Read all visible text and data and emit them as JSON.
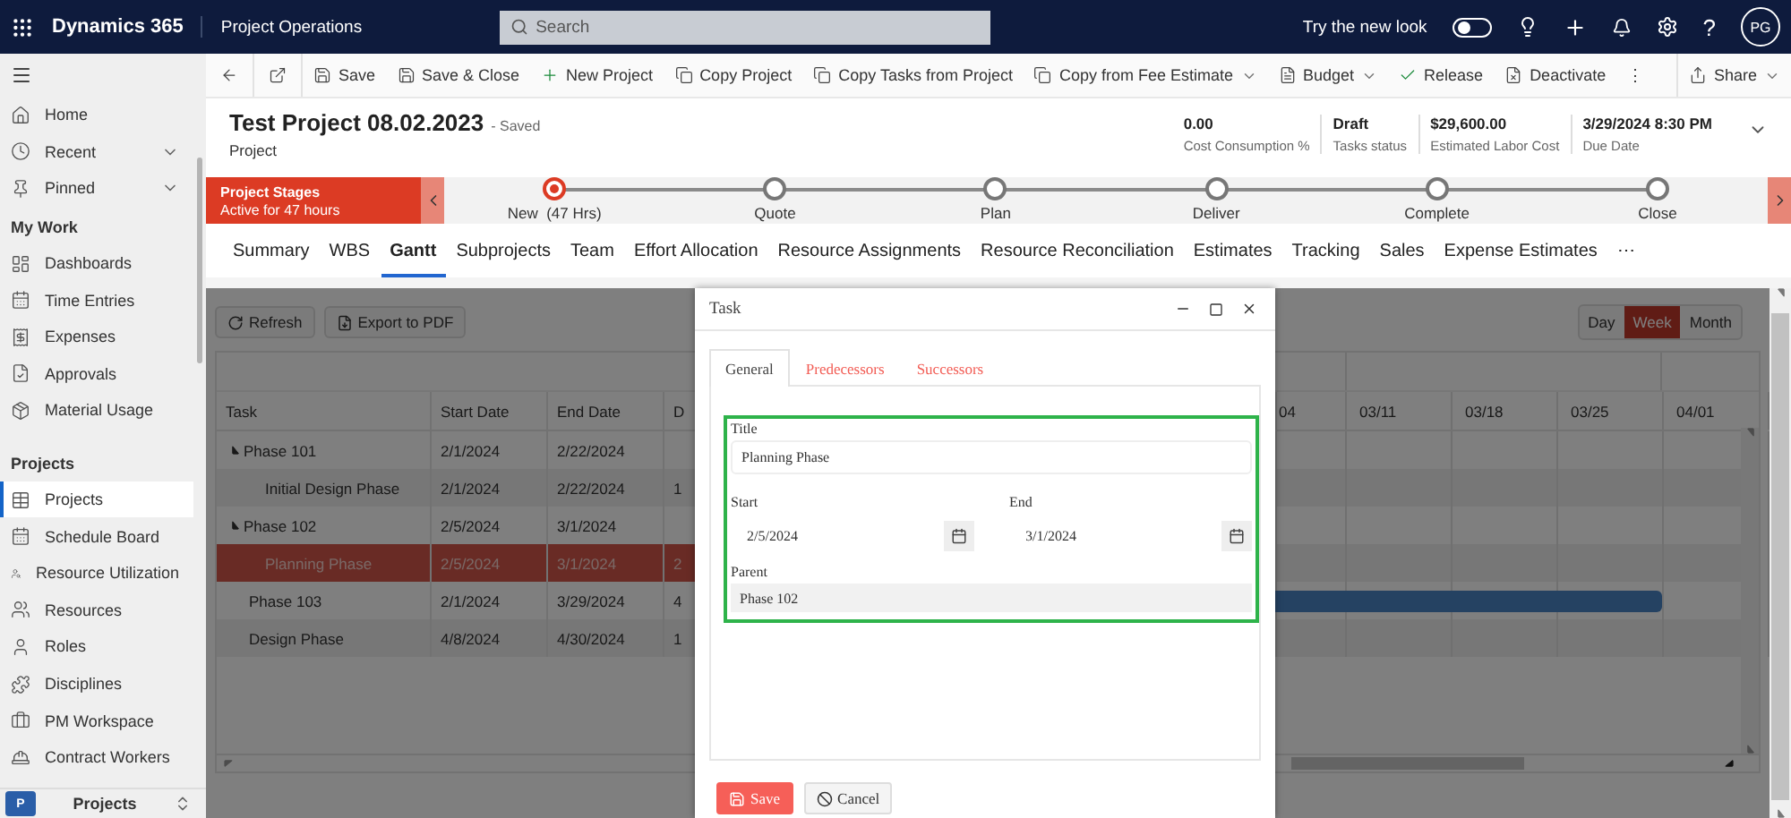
{
  "top_bar": {
    "app_name": "Dynamics 365",
    "area": "Project Operations",
    "search": {
      "placeholder": "Search"
    },
    "new_look": {
      "label": "Try the new look",
      "on": false
    },
    "help": "?",
    "avatar": "PG"
  },
  "sidebar": {
    "items": [
      {
        "label": "Home",
        "kind": "home",
        "selected": false,
        "expandable": false
      },
      {
        "label": "Recent",
        "kind": "recent",
        "selected": false,
        "expandable": true
      },
      {
        "label": "Pinned",
        "kind": "pinned",
        "selected": false,
        "expandable": true
      }
    ],
    "sections": [
      {
        "title": "My Work",
        "items": [
          {
            "label": "Dashboards",
            "kind": "dashboards",
            "selected": false
          },
          {
            "label": "Time Entries",
            "kind": "calendar",
            "selected": false
          },
          {
            "label": "Expenses",
            "kind": "expenses",
            "selected": false
          },
          {
            "label": "Approvals",
            "kind": "approvals",
            "selected": false
          },
          {
            "label": "Material Usage",
            "kind": "material",
            "selected": false
          }
        ]
      },
      {
        "title": "Projects",
        "items": [
          {
            "label": "Projects",
            "kind": "table",
            "selected": true
          },
          {
            "label": "Schedule Board",
            "kind": "calendar",
            "selected": false
          },
          {
            "label": "Resource Utilization",
            "kind": "utilization",
            "selected": false
          },
          {
            "label": "Resources",
            "kind": "resources",
            "selected": false
          },
          {
            "label": "Roles",
            "kind": "roles",
            "selected": false
          },
          {
            "label": "Disciplines",
            "kind": "disciplines",
            "selected": false
          },
          {
            "label": "PM Workspace",
            "kind": "workspace",
            "selected": false
          },
          {
            "label": "Contract Workers",
            "kind": "workers",
            "selected": false
          }
        ]
      }
    ],
    "area_switcher": {
      "badge": "P",
      "label": "Projects"
    }
  },
  "command_bar": [
    {
      "kind": "back"
    },
    {
      "kind": "popout"
    },
    {
      "label": "Save",
      "kind": "save",
      "dropdown": false
    },
    {
      "label": "Save & Close",
      "kind": "save-close",
      "dropdown": false
    },
    {
      "label": "New Project",
      "kind": "new",
      "dropdown": false
    },
    {
      "label": "Copy Project",
      "kind": "copy",
      "dropdown": false
    },
    {
      "label": "Copy Tasks from Project",
      "kind": "copy",
      "dropdown": false
    },
    {
      "label": "Copy from Fee Estimate",
      "kind": "copy",
      "dropdown": true
    },
    {
      "label": "Budget",
      "kind": "document",
      "dropdown": true
    },
    {
      "label": "Release",
      "kind": "check",
      "dropdown": false
    },
    {
      "label": "Deactivate",
      "kind": "deactivate",
      "dropdown": false
    },
    {
      "label": "⋮",
      "kind": "more",
      "dropdown": false
    },
    {
      "label": "Share",
      "kind": "share",
      "dropdown": true
    }
  ],
  "header": {
    "title": "Test Project 08.02.2023",
    "status": "- Saved",
    "entity": "Project",
    "fields": [
      {
        "value": "0.00",
        "label": "Cost Consumption %"
      },
      {
        "value": "Draft",
        "label": "Tasks status"
      },
      {
        "value": "$29,600.00",
        "label": "Estimated Labor Cost"
      },
      {
        "value": "3/29/2024 8:30 PM",
        "label": "Due Date"
      }
    ]
  },
  "stages": {
    "title": "Project Stages",
    "subtitle": "Active for 47 hours",
    "items": [
      {
        "label": "New  (47 Hrs)",
        "selected": true
      },
      {
        "label": "Quote",
        "selected": false
      },
      {
        "label": "Plan",
        "selected": false
      },
      {
        "label": "Deliver",
        "selected": false
      },
      {
        "label": "Complete",
        "selected": false
      },
      {
        "label": "Close",
        "selected": false
      }
    ]
  },
  "tabs": [
    {
      "label": "Summary",
      "selected": false
    },
    {
      "label": "WBS",
      "selected": false
    },
    {
      "label": "Gantt",
      "selected": true
    },
    {
      "label": "Subprojects",
      "selected": false
    },
    {
      "label": "Team",
      "selected": false
    },
    {
      "label": "Effort Allocation",
      "selected": false
    },
    {
      "label": "Resource Assignments",
      "selected": false
    },
    {
      "label": "Resource Reconciliation",
      "selected": false
    },
    {
      "label": "Estimates",
      "selected": false
    },
    {
      "label": "Tracking",
      "selected": false
    },
    {
      "label": "Sales",
      "selected": false
    },
    {
      "label": "Expense Estimates",
      "selected": false
    },
    {
      "label": "⋯",
      "selected": false
    }
  ],
  "gantt": {
    "buttons": [
      {
        "label": "Refresh",
        "kind": "refresh"
      },
      {
        "label": "Export to PDF",
        "kind": "pdf"
      }
    ],
    "views": [
      {
        "label": "Day",
        "selected": false
      },
      {
        "label": "Week",
        "selected": true
      },
      {
        "label": "Month",
        "selected": false
      }
    ],
    "columns": [
      "Task",
      "Start Date",
      "End Date",
      "D"
    ],
    "timeline": [
      "04",
      "03/11",
      "03/18",
      "03/25",
      "04/01"
    ],
    "rows": [
      {
        "task": "Phase 101",
        "start": "2/1/2024",
        "end": "2/22/2024",
        "selected": false,
        "bar": false,
        "expanded": true,
        "children": [
          {
            "task": "Initial Design Phase",
            "start": "2/1/2024",
            "end": "2/22/2024",
            "column_4": "1",
            "selected": false,
            "bar": false
          }
        ]
      },
      {
        "task": "Phase 102",
        "start": "2/5/2024",
        "end": "3/1/2024",
        "selected": false,
        "bar": false,
        "expanded": true,
        "children": [
          {
            "task": "Planning Phase",
            "start": "2/5/2024",
            "end": "3/1/2024",
            "column_4": "2",
            "selected": true,
            "bar": false
          }
        ]
      },
      {
        "task": "Phase 103",
        "start": "2/1/2024",
        "end": "3/29/2024",
        "column_4": "4",
        "selected": false,
        "bar": true
      },
      {
        "task": "Design Phase",
        "start": "4/8/2024",
        "end": "4/30/2024",
        "column_4": "1",
        "selected": false,
        "bar": false
      }
    ]
  },
  "dialog": {
    "title": "Task",
    "tabs": [
      {
        "label": "General",
        "selected": true
      },
      {
        "label": "Predecessors",
        "selected": false
      },
      {
        "label": "Successors",
        "selected": false
      }
    ],
    "title_field": {
      "label": "Title",
      "value": "Planning Phase"
    },
    "start_field": {
      "label": "Start",
      "value": "2/5/2024"
    },
    "end_field": {
      "label": "End",
      "value": "3/1/2024"
    },
    "parent_field": {
      "label": "Parent",
      "value": "Phase 102"
    },
    "buttons": [
      {
        "label": "Save",
        "kind": "primary"
      },
      {
        "label": "Cancel",
        "kind": "cancel"
      }
    ]
  }
}
